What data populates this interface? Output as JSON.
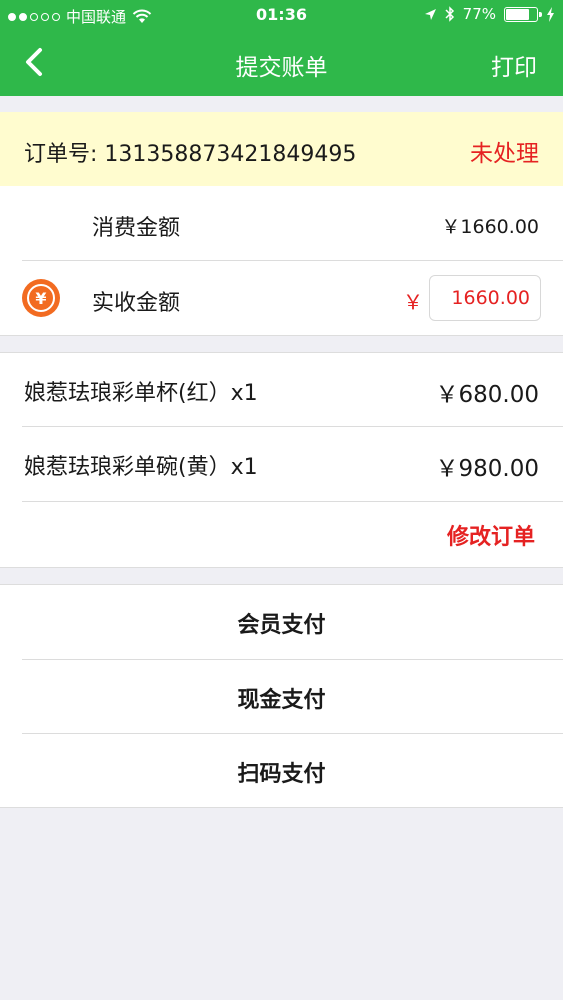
{
  "status_bar": {
    "carrier": "中国联通",
    "time": "01:36",
    "battery": "77%",
    "battery_level": 0.77
  },
  "nav": {
    "title": "提交账单",
    "print_label": "打印"
  },
  "order": {
    "number_text": "订单号: 131358873421849495",
    "status": "未处理"
  },
  "amounts": {
    "consume_label": "消费金额",
    "consume_value": "￥1660.00",
    "received_label": "实收金额",
    "received_currency": "￥",
    "received_value": "1660.00",
    "coin_icon_glyph": "¥"
  },
  "items": [
    {
      "name": "娘惹珐琅彩单杯(红）x1",
      "price": "￥680.00"
    },
    {
      "name": "娘惹珐琅彩单碗(黄）x1",
      "price": "￥980.00"
    }
  ],
  "modify_label": "修改订单",
  "payments": [
    {
      "label": "会员支付"
    },
    {
      "label": "现金支付"
    },
    {
      "label": "扫码支付"
    }
  ],
  "colors": {
    "header_green": "#2fb84a",
    "accent_red": "#e52222",
    "order_bar_bg": "#fffccf",
    "coin_orange": "#f26b21"
  }
}
